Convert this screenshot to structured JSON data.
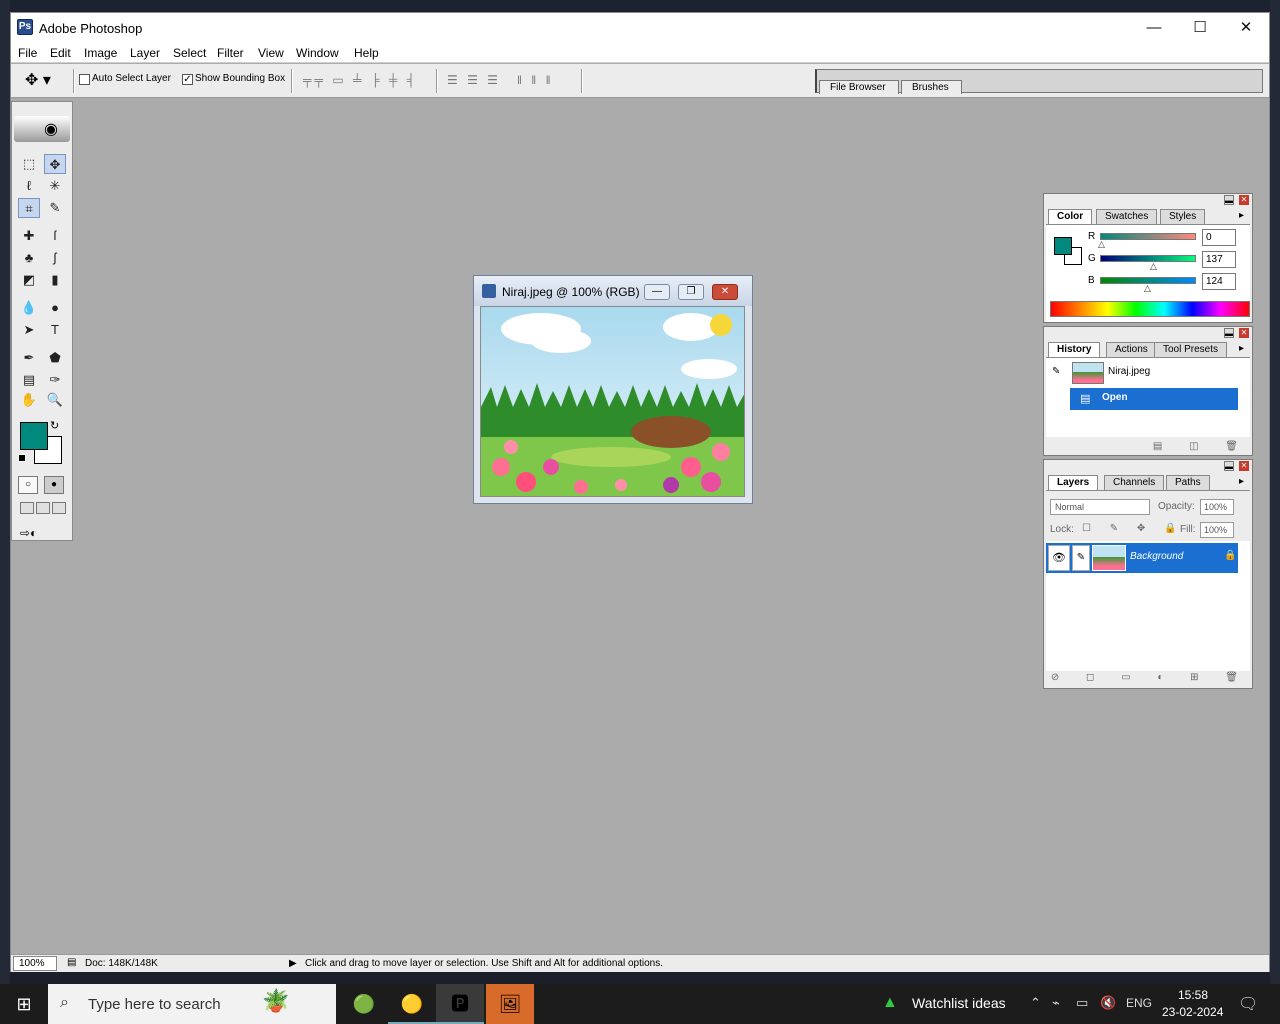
{
  "window": {
    "title": "Adobe Photoshop",
    "min_symbol": "—",
    "max_symbol": "☐",
    "close_symbol": "✕"
  },
  "menu": [
    "File",
    "Edit",
    "Image",
    "Layer",
    "Select",
    "Filter",
    "View",
    "Window",
    "Help"
  ],
  "options_bar": {
    "auto_select_label": "Auto Select Layer",
    "auto_select_checked": false,
    "bounding_box_label": "Show Bounding Box",
    "bounding_box_checked": true,
    "palette_well_tabs": [
      "File Browser",
      "Brushes"
    ]
  },
  "toolbox": {
    "foreground_color": "#00897c",
    "background_color": "#ffffff",
    "tools": [
      "marquee-icon",
      "move-icon",
      "lasso-icon",
      "magic-wand-icon",
      "crop-icon",
      "slice-icon",
      "healing-brush-icon",
      "brush-icon",
      "clone-stamp-icon",
      "history-brush-icon",
      "eraser-icon",
      "gradient-icon",
      "blur-icon",
      "dodge-icon",
      "path-select-icon",
      "type-icon",
      "pen-icon",
      "shape-icon",
      "notes-icon",
      "eyedropper-icon",
      "hand-icon",
      "zoom-icon"
    ],
    "glyphs": [
      "⬚",
      "✥",
      "ℓ",
      "✳",
      "⌗",
      "✎",
      "✚",
      "ſ",
      "♣",
      "ʃ",
      "◩",
      "▮",
      "💧",
      "●",
      "➤",
      "T",
      "✒",
      "⬟",
      "▤",
      "✑",
      "✋",
      "🔍"
    ]
  },
  "document": {
    "title": "Niraj.jpeg @ 100% (RGB)"
  },
  "color_palette": {
    "tabs": [
      "Color",
      "Swatches",
      "Styles"
    ],
    "channels": [
      {
        "label": "R",
        "value": "0"
      },
      {
        "label": "G",
        "value": "137"
      },
      {
        "label": "B",
        "value": "124"
      }
    ]
  },
  "history_palette": {
    "tabs": [
      "History",
      "Actions",
      "Tool Presets"
    ],
    "snapshot_label": "Niraj.jpeg",
    "states": [
      "Open"
    ]
  },
  "layers_palette": {
    "tabs": [
      "Layers",
      "Channels",
      "Paths"
    ],
    "blend_mode": "Normal",
    "opacity_label": "Opacity:",
    "opacity": "100%",
    "lock_label": "Lock:",
    "fill_label": "Fill:",
    "fill": "100%",
    "layer_name": "Background"
  },
  "status_bar": {
    "zoom": "100%",
    "doc_info": "Doc: 148K/148K",
    "message": "Click and drag to move layer or selection.  Use Shift and Alt for additional options."
  },
  "taskbar": {
    "search_placeholder": "Type here to search",
    "watchlist": "Watchlist ideas",
    "language": "ENG",
    "time": "15:58",
    "date": "23-02-2024"
  }
}
